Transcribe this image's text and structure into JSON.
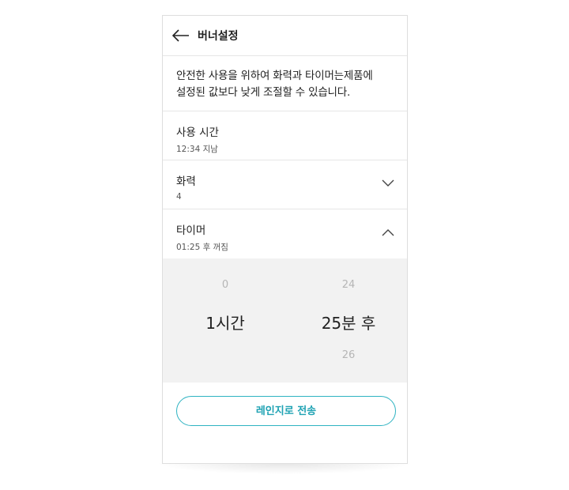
{
  "header": {
    "title": "버너설정"
  },
  "notice": {
    "line1": "안전한 사용을 위하여 화력과 타이머는제품에",
    "line2": "설정된 값보다 낮게 조절할 수 있습니다."
  },
  "settings": {
    "usage_time": {
      "label": "사용 시간",
      "value": "12:34 지남"
    },
    "heat": {
      "label": "화력",
      "value": "4"
    },
    "timer": {
      "label": "타이머",
      "value": "01:25 후 꺼짐"
    }
  },
  "picker": {
    "hours": {
      "above": "0",
      "selected": "1시간"
    },
    "minutes": {
      "above": "24",
      "selected": "25분 후",
      "below": "26"
    }
  },
  "actions": {
    "send_label": "레인지로 전송"
  },
  "colors": {
    "accent": "#2fb3c2",
    "picker_bg": "#f2f2f2"
  }
}
